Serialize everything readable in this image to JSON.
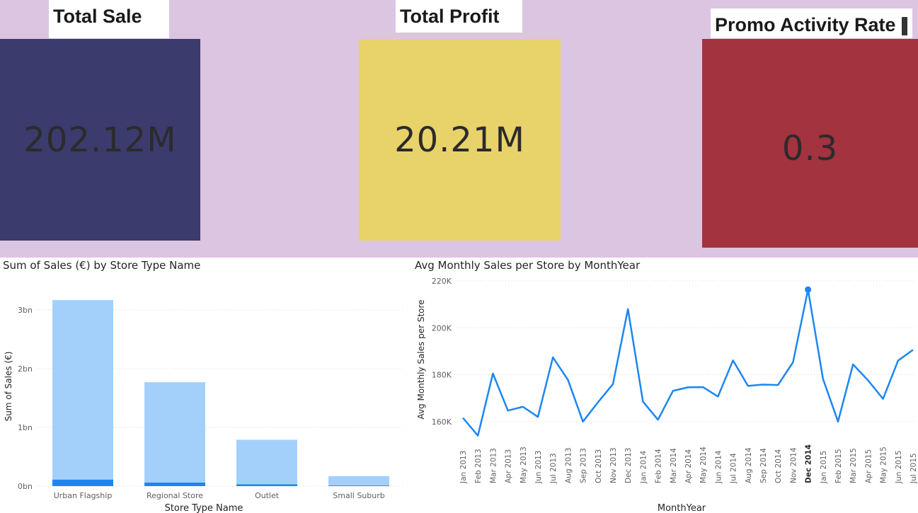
{
  "kpis": {
    "total_sale": {
      "label": "Total Sale",
      "value": "202.12M",
      "color": "#3b3b6e"
    },
    "total_profit": {
      "label": "Total Profit",
      "value": "20.21M",
      "color": "#e8d26a"
    },
    "promo_rate": {
      "label": "Promo Activity Rate",
      "value": "0.3",
      "color": "#a2333f"
    }
  },
  "colors": {
    "band": "#dcc5e1",
    "bar_light": "#a3d0fb",
    "bar_dark": "#1c86f2",
    "line": "#1c86f2"
  },
  "chart_data": [
    {
      "type": "bar",
      "title": "Sum of Sales (€) by Store Type Name",
      "xlabel": "Store Type Name",
      "ylabel": "Sum of Sales (€)",
      "categories": [
        "Urban Flagship",
        "Regional Store",
        "Outlet",
        "Small Suburb"
      ],
      "series": [
        {
          "values": [
            3.17,
            1.77,
            0.79,
            0.17
          ]
        },
        {
          "values": [
            0.11,
            0.06,
            0.03,
            0.01
          ]
        }
      ],
      "ylim": [
        0,
        3.4
      ],
      "yticks": [
        0,
        1,
        2,
        3
      ],
      "ytick_labels": [
        "0bn",
        "1bn",
        "2bn",
        "3bn"
      ],
      "grid": true
    },
    {
      "type": "line",
      "title": "Avg Monthly Sales per Store by MonthYear",
      "xlabel": "MonthYear",
      "ylabel": "Avg Monthly Sales per Store",
      "x": [
        "Jan 2013",
        "Feb 2013",
        "Mar 2013",
        "Apr 2013",
        "May 2013",
        "Jun 2013",
        "Jul 2013",
        "Aug 2013",
        "Sep 2013",
        "Oct 2013",
        "Nov 2013",
        "Dec 2013",
        "Jan 2014",
        "Feb 2014",
        "Mar 2014",
        "Apr 2014",
        "May 2014",
        "Jun 2014",
        "Jul 2014",
        "Aug 2014",
        "Sep 2014",
        "Oct 2014",
        "Nov 2014",
        "Dec 2014",
        "Jan 2015",
        "Feb 2015",
        "Mar 2015",
        "Apr 2015",
        "May 2015",
        "Jun 2015",
        "Jul 2015"
      ],
      "y": [
        161600,
        154000,
        180500,
        164700,
        166300,
        162000,
        187400,
        177800,
        160000,
        168200,
        176000,
        208000,
        168500,
        160800,
        173100,
        174600,
        174700,
        170700,
        186100,
        175200,
        175800,
        175600,
        185300,
        216300,
        178200,
        160000,
        184400,
        177600,
        169700,
        186000,
        190600
      ],
      "highlight": "Dec 2014",
      "ylim": [
        153000,
        220000
      ],
      "yticks": [
        160000,
        180000,
        200000,
        220000
      ],
      "ytick_labels": [
        "160K",
        "180K",
        "200K",
        "220K"
      ],
      "grid": true
    }
  ]
}
